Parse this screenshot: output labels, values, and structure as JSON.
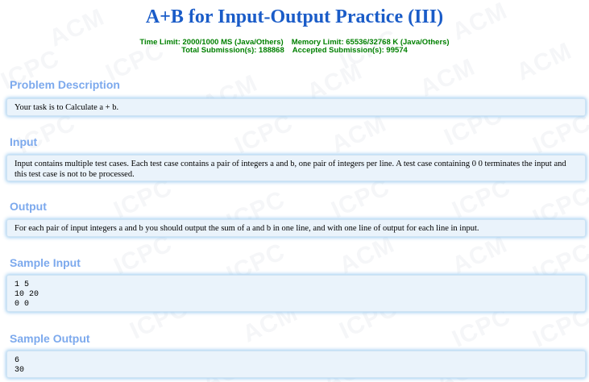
{
  "title": "A+B for Input-Output Practice (III)",
  "limits": {
    "time_limit": "Time Limit: 2000/1000 MS (Java/Others)",
    "memory_limit": "Memory Limit: 65536/32768 K (Java/Others)",
    "total_submissions": "Total Submission(s): 188868",
    "accepted_submissions": "Accepted Submission(s): 99574"
  },
  "sections": {
    "description": {
      "heading": "Problem Description",
      "text": "Your task is to Calculate a + b."
    },
    "input": {
      "heading": "Input",
      "text": "Input contains multiple test cases. Each test case contains a pair of integers a and b, one pair of integers per line. A test case containing 0 0 terminates the input and this test case is not to be processed."
    },
    "output": {
      "heading": "Output",
      "text": "For each pair of input integers a and b you should output the sum of a and b in one line, and with one line of output for each line in input."
    },
    "sample_input": {
      "heading": "Sample Input",
      "text": "1 5\n10 20\n0 0"
    },
    "sample_output": {
      "heading": "Sample Output",
      "text": "6\n30"
    }
  }
}
